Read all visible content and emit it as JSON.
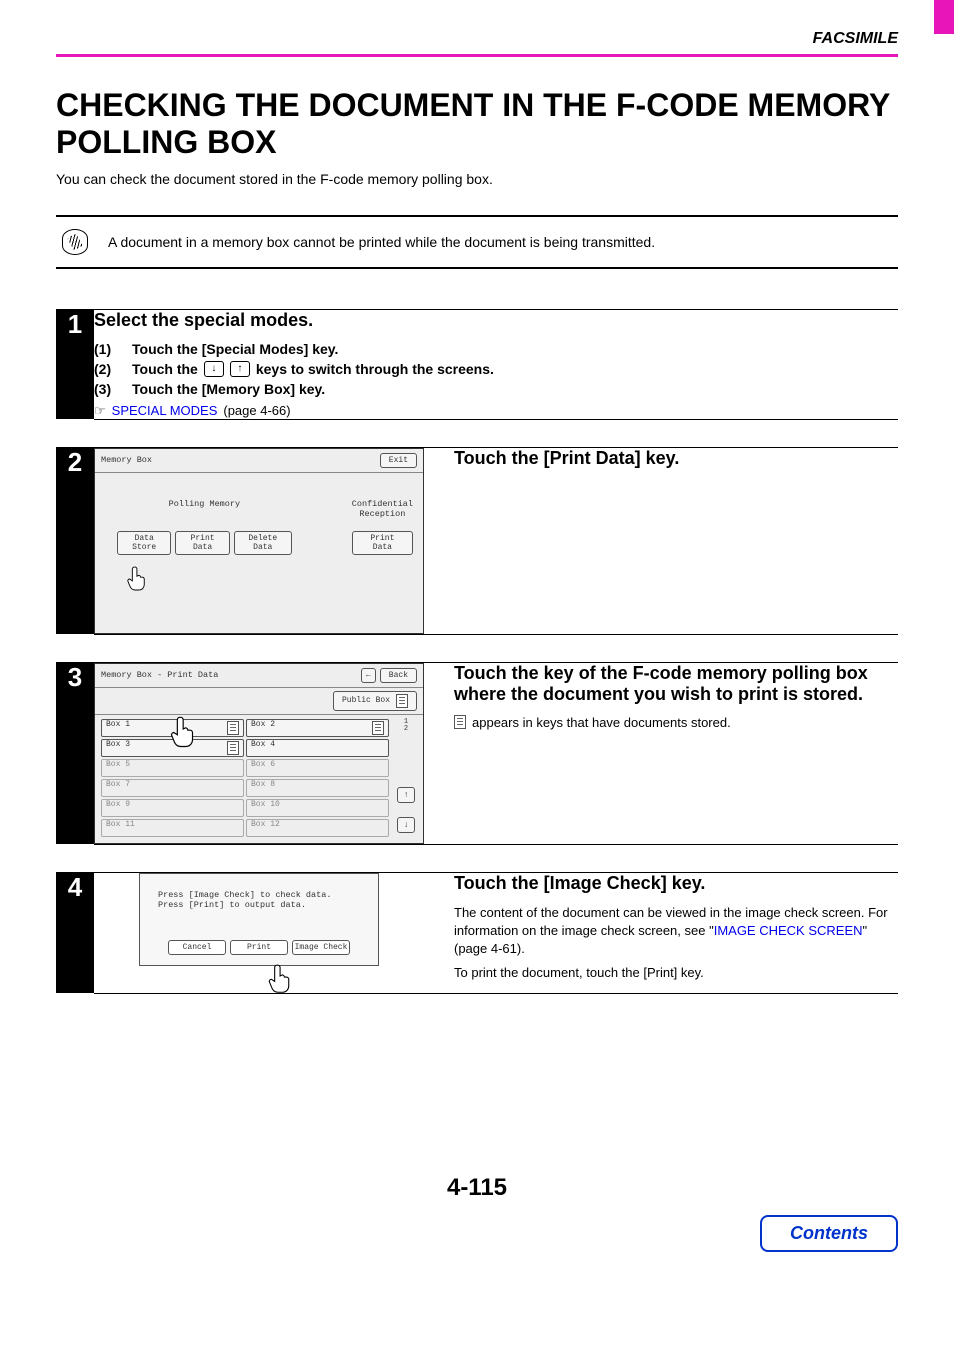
{
  "header": {
    "section": "FACSIMILE"
  },
  "title": "CHECKING THE DOCUMENT IN THE F-CODE MEMORY POLLING BOX",
  "intro": "You can check the document stored in the F-code memory polling box.",
  "note": "A document in a memory box cannot be printed while the document is being transmitted.",
  "step1": {
    "num": "1",
    "title": "Select the special modes.",
    "sub1_num": "(1)",
    "sub1": "Touch the [Special Modes] key.",
    "sub2_num": "(2)",
    "sub2_a": "Touch the",
    "sub2_b": "keys to switch through the screens.",
    "sub3_num": "(3)",
    "sub3": "Touch the [Memory Box] key.",
    "ref_icon": "☞",
    "ref_link": "SPECIAL MODES",
    "ref_tail": " (page 4-66)"
  },
  "step2": {
    "num": "2",
    "title": "Touch the [Print Data] key.",
    "screen": {
      "title": "Memory Box",
      "exit": "Exit",
      "group1_label": "Polling Memory",
      "btn_a": "Data Store",
      "btn_b": "Print Data",
      "btn_c": "Delete Data",
      "group2_label": "Confidential\nReception",
      "btn_d": "Print Data"
    }
  },
  "step3": {
    "num": "3",
    "title": "Touch the key of the F-code memory polling box where the document you wish to print is stored.",
    "desc": "appears in keys that have documents stored.",
    "screen": {
      "title": "Memory Box - Print Data",
      "back": "Back",
      "public": "Public Box",
      "page_top": "1",
      "page_bot": "2",
      "boxes": [
        {
          "label": "Box 1",
          "doc": true,
          "active": true
        },
        {
          "label": "Box 2",
          "doc": true,
          "active": true
        },
        {
          "label": "Box 3",
          "doc": true,
          "active": true
        },
        {
          "label": "Box 4",
          "doc": false,
          "active": true
        },
        {
          "label": "Box 5",
          "doc": false,
          "active": false
        },
        {
          "label": "Box 6",
          "doc": false,
          "active": false
        },
        {
          "label": "Box 7",
          "doc": false,
          "active": false
        },
        {
          "label": "Box 8",
          "doc": false,
          "active": false
        },
        {
          "label": "Box 9",
          "doc": false,
          "active": false
        },
        {
          "label": "Box 10",
          "doc": false,
          "active": false
        },
        {
          "label": "Box 11",
          "doc": false,
          "active": false
        },
        {
          "label": "Box 12",
          "doc": false,
          "active": false
        }
      ]
    }
  },
  "step4": {
    "num": "4",
    "title": "Touch the [Image Check] key.",
    "p1": "The content of the document can be viewed in the image check screen. For information on the image check screen, see \"",
    "link": "IMAGE CHECK SCREEN",
    "p1b": "\" (page 4-61).",
    "p2": "To print the document, touch the [Print] key.",
    "screen": {
      "line1": "Press [Image Check] to check data.",
      "line2": "Press [Print] to output data.",
      "cancel": "Cancel",
      "print": "Print",
      "image_check": "Image Check"
    }
  },
  "footer": {
    "page": "4-115",
    "contents": "Contents"
  }
}
